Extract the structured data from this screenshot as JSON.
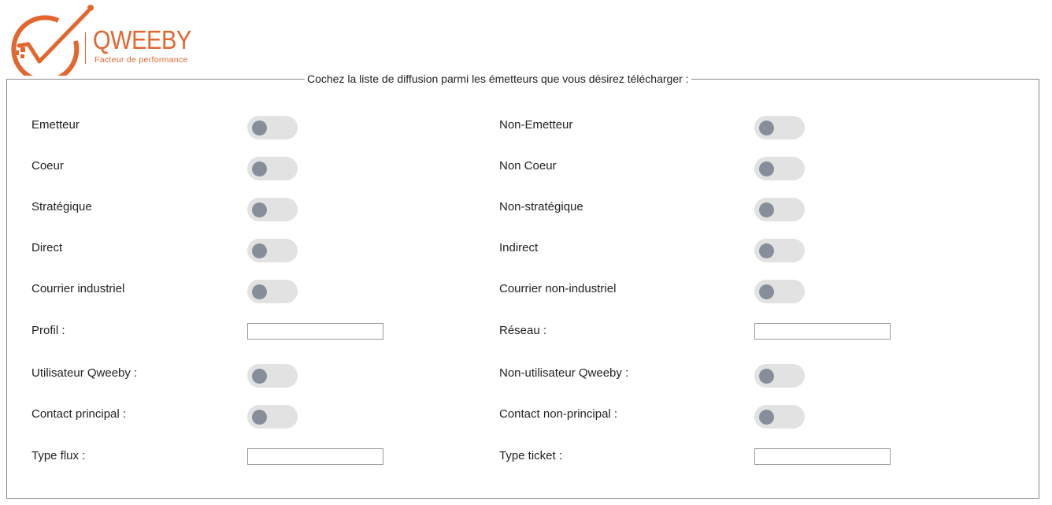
{
  "logo": {
    "brand": "QWEEBY",
    "tagline": "Facteur de performance",
    "accent_color": "#e3662e"
  },
  "form": {
    "legend": "Cochez la liste de diffusion parmi les émetteurs que vous désirez télécharger :",
    "toggle_state": "off",
    "fields": {
      "emetteur": "Emetteur",
      "non_emetteur": "Non-Emetteur",
      "coeur": "Coeur",
      "non_coeur": "Non Coeur",
      "strategique": "Stratégique",
      "non_strategique": "Non-stratégique",
      "direct": "Direct",
      "indirect": "Indirect",
      "courrier_industriel": "Courrier industriel",
      "courrier_non_industriel": "Courrier non-industriel",
      "profil": "Profil :",
      "reseau": "Réseau :",
      "utilisateur_qweeby": "Utilisateur Qweeby :",
      "non_utilisateur_qweeby": "Non-utilisateur Qweeby :",
      "contact_principal": "Contact principal :",
      "contact_non_principal": "Contact non-principal :",
      "type_flux": "Type flux :",
      "type_ticket": "Type ticket :"
    },
    "inputs": {
      "profil": "",
      "reseau": "",
      "type_flux": "",
      "type_ticket": ""
    },
    "colors": {
      "toggle_track": "#e2e2e2",
      "toggle_knob": "#868f99",
      "border": "#8a8a8a"
    }
  }
}
